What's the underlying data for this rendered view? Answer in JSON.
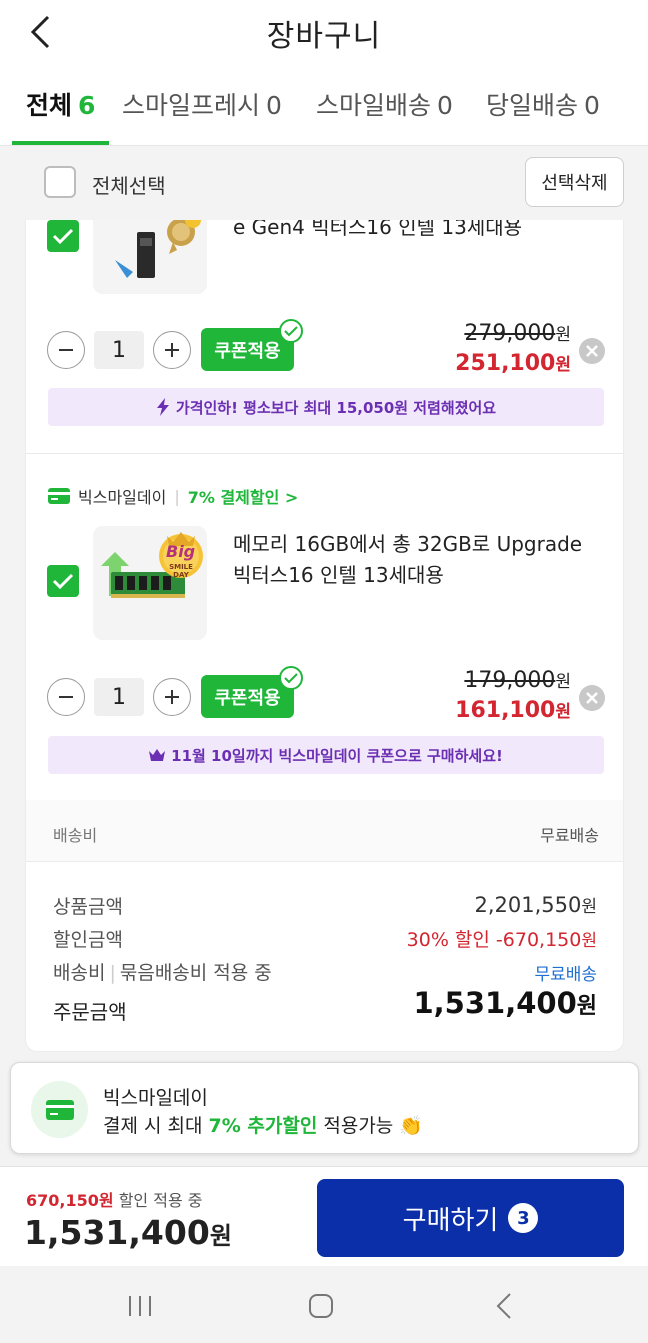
{
  "header": {
    "title": "장바구니"
  },
  "tabs": [
    {
      "label": "전체",
      "count": "6"
    },
    {
      "label": "스마일프레시",
      "count": "0"
    },
    {
      "label": "스마일배송",
      "count": "0"
    },
    {
      "label": "당일배송",
      "count": "0"
    }
  ],
  "select_bar": {
    "select_all_label": "전체선택",
    "delete_label": "선택삭제"
  },
  "items": [
    {
      "name": "e Gen4 빅터스16 인텔 13세대용",
      "quantity": "1",
      "coupon_label": "쿠폰적용",
      "original_price": "279,000",
      "sale_price": "251,100",
      "won": "원",
      "promo": "가격인하! 평소보다 최대 15,050원 저렴해졌어요"
    },
    {
      "store": "빅스마일데이",
      "store_discount": "7% 결제할인 >",
      "badge_text": "Big",
      "badge_sub": "SMILE DAY",
      "name": "메모리 16GB에서 총 32GB로 Upgrade 빅터스16 인텔 13세대용",
      "quantity": "1",
      "coupon_label": "쿠폰적용",
      "original_price": "179,000",
      "sale_price": "161,100",
      "won": "원",
      "promo": "11월 10일까지 빅스마일데이 쿠폰으로 구매하세요!"
    }
  ],
  "shipping": {
    "label": "배송비",
    "value": "무료배송"
  },
  "summary": {
    "product_label": "상품금액",
    "product_value": "2,201,550",
    "discount_label": "할인금액",
    "discount_value": "30% 할인 -670,150",
    "shipping_label": "배송비",
    "shipping_note": "묶음배송비 적용 중",
    "shipping_value": "무료배송",
    "order_label": "주문금액",
    "order_value": "1,531,400",
    "won": "원"
  },
  "banner": {
    "title": "빅스마일데이",
    "line_prefix": "결제 시 최대 ",
    "line_highlight": "7% 추가할인",
    "line_suffix": " 적용가능",
    "emoji": "👏"
  },
  "bottom": {
    "discount_amount": "670,150원",
    "discount_text": " 할인 적용 중",
    "total": "1,531,400",
    "won": "원",
    "buy_label": "구매하기",
    "buy_count": "3"
  },
  "colors": {
    "accent_green": "#1fb63a",
    "sale_red": "#d32630",
    "buy_blue": "#0a2fa8",
    "promo_purple": "#6b2fb3"
  }
}
